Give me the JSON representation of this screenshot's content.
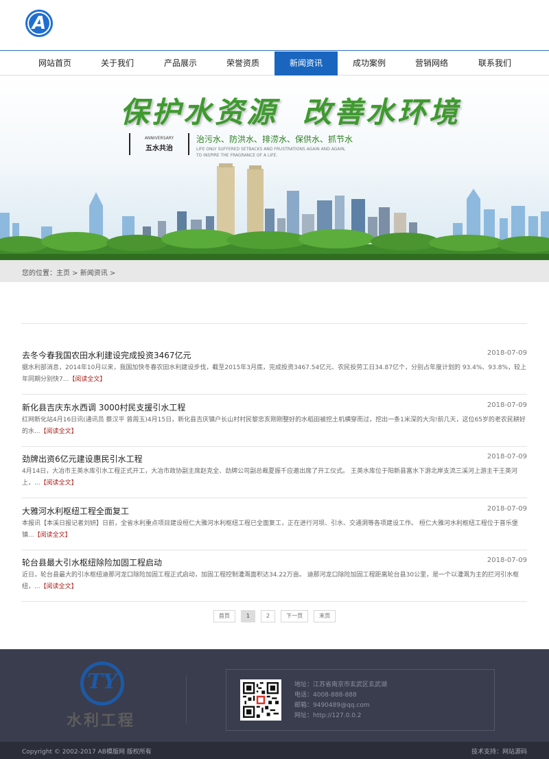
{
  "header": {
    "logo_letter": "A"
  },
  "nav": {
    "items": [
      "网站首页",
      "关于我们",
      "产品展示",
      "荣誉资质",
      "新闻资讯",
      "成功案例",
      "营销网络",
      "联系我们"
    ],
    "active": "新闻资讯"
  },
  "banner": {
    "slogan_1": "保护水资源",
    "slogan_2": "改善水环境",
    "ann_en": "ANNIVERSARY",
    "ann_cn": "五水共治",
    "tagline": "治污水、防洪水、排涝水、保供水、抓节水",
    "en_line_1": "LIFE ONLY SUFFERED SETBACKS AND FRUSTRATIONS AGAIN AND AGAIN,",
    "en_line_2": "TO INSPIRE THE FRAGRANCE OF A LIFE."
  },
  "breadcrumb": {
    "text": "您的位置：主页 > 新闻资讯 >"
  },
  "news": [
    {
      "title": "去冬今春我国农田水利建设完成投资3467亿元",
      "date": "2018-07-09",
      "desc": "据水利部消息，2014年10月以来，我国加快冬春农田水利建设步伐，截至2015年3月底，完成投资3467.54亿元、农民投劳工日34.87亿个，分别占年度计划的 93.4%、93.8%，较上年同期分别快7...",
      "more": "【阅读全文】"
    },
    {
      "title": "新化县吉庆东水西调 3000村民支援引水工程",
      "date": "2018-07-09",
      "desc": "红网新化站4月16日讯(通讯员 蔡汉平 曾周玉)4月15日，新化县吉庆镇户长山村村民黎忠亥刚刚整好的水稻田被挖土机横穿而过，挖出一条1米深的大沟!前几天，这位65岁的老农民耕好的水...",
      "more": "【阅读全文】"
    },
    {
      "title": "劲牌出资6亿元建设惠民引水工程",
      "date": "2018-07-09",
      "desc": "4月14日，大冶市王英水库引水工程正式开工，大冶市政协副主席赵克全、劲牌公司副总裁夏振千应邀出席了开工仪式。 王英水库位于阳新县富水下游北岸支流三溪河上游主干王英河上，...",
      "more": "【阅读全文】"
    },
    {
      "title": "大雅河水利枢纽工程全面复工",
      "date": "2018-07-09",
      "desc": "本报讯【本溪日报记者刘妍】日前，全省水利重点项目建设桓仁大雅河水利枢纽工程已全面复工，正在进行河坝、引水、交通洞等各项建设工作。 桓仁大雅河水利枢纽工程位于普乐堡镇...",
      "more": "【阅读全文】"
    },
    {
      "title": "轮台县最大引水枢纽除险加固工程启动",
      "date": "2018-07-09",
      "desc": "近日，轮台县最大的引水枢纽迪那河龙口除险加固工程正式启动，加固工程控制灌溉面积达34.22万亩。 迪那河龙口除险加固工程距离轮台县30公里，是一个以灌溉为主的拦河引水枢纽，...",
      "more": "【阅读全文】"
    }
  ],
  "pager": {
    "first": "首页",
    "page1": "1",
    "page2": "2",
    "next": "下一页",
    "last": "末页"
  },
  "footer": {
    "logo_letters": "TY",
    "logo_cn": "水利工程",
    "address": "地址：江苏省南京市玄武区玄武湖",
    "phone": "电话：4008-888-888",
    "email": "邮箱：9490489@qq.com",
    "website": "网址：http://127.0.0.2",
    "copyright": "Copyright © 2002-2017 AB模版网 版权所有",
    "tech": "技术支持：网站源码"
  },
  "colors": {
    "primary": "#1a66be",
    "footer_bg": "#3a3d4d",
    "more_link": "#a8221e",
    "slogan_green": "#3e9a2e"
  }
}
